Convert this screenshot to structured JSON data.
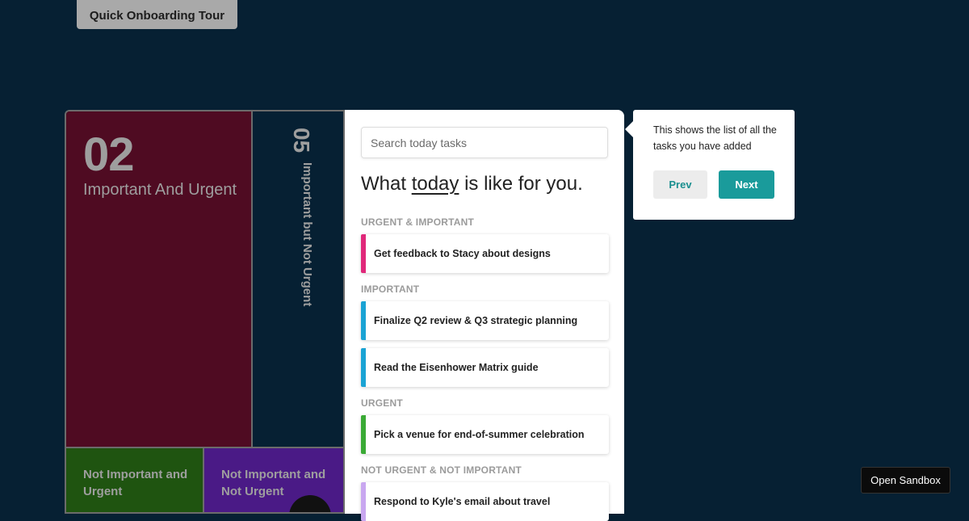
{
  "tour": {
    "label": "Quick Onboarding Tour"
  },
  "matrix": {
    "important_urgent": {
      "count": "02",
      "label": "Important And Urgent",
      "color": "#4f0b22"
    },
    "important_not_urgent": {
      "count": "05",
      "label": "Important but Not Urgent",
      "color": "#062033"
    },
    "not_important_urgent": {
      "label": "Not Important and Urgent",
      "color": "#1f5410"
    },
    "not_important_not_urgent": {
      "label": "Not Important and Not Urgent",
      "color": "#4a1a86"
    }
  },
  "panel": {
    "search_placeholder": "Search today tasks",
    "heading_pre": "What ",
    "heading_word": "today",
    "heading_post": " is like for you.",
    "sections": [
      {
        "title": "URGENT & IMPORTANT",
        "color": "#e0287a",
        "tasks": [
          "Get feedback to Stacy about designs"
        ]
      },
      {
        "title": "IMPORTANT",
        "color": "#1aa3d4",
        "tasks": [
          "Finalize Q2 review & Q3 strategic planning",
          "Read the Eisenhower Matrix guide"
        ]
      },
      {
        "title": "URGENT",
        "color": "#3aaa35",
        "tasks": [
          "Pick a venue for end-of-summer celebration"
        ]
      },
      {
        "title": "NOT URGENT & NOT IMPORTANT",
        "color": "#c9a7f0",
        "tasks": [
          "Respond to Kyle's email about travel"
        ]
      }
    ]
  },
  "tooltip": {
    "message": "This shows the list of all the tasks you have added",
    "prev_label": "Prev",
    "next_label": "Next"
  },
  "sandbox": {
    "label": "Open Sandbox"
  }
}
